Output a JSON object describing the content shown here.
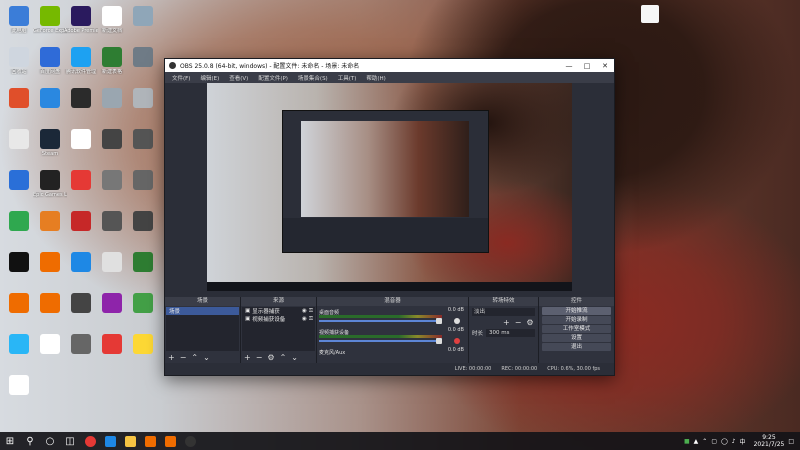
{
  "desktop": {
    "icons": [
      {
        "label": "此电脑",
        "color": "#3b7dd8"
      },
      {
        "label": "GeForce Experience",
        "color": "#76b900"
      },
      {
        "label": "Adobe Premiere Pro",
        "color": "#2a1a5e"
      },
      {
        "label": "新建文档",
        "color": "#ffffff"
      },
      {
        "label": "",
        "color": "#8fa6b8"
      },
      {
        "label": "回收站",
        "color": "#cfd6df"
      },
      {
        "label": "百度网盘",
        "color": "#2f6bd8"
      },
      {
        "label": "腾讯软件管理",
        "color": "#1da1f2"
      },
      {
        "label": "新建表格",
        "color": "#2e7d32"
      },
      {
        "label": "",
        "color": "#6f7b86"
      },
      {
        "label": "",
        "color": "#e04f2a"
      },
      {
        "label": "",
        "color": "#2a88e0"
      },
      {
        "label": "",
        "color": "#2b2b2b"
      },
      {
        "label": "",
        "color": "#9aa6b0"
      },
      {
        "label": "",
        "color": "#b0b5ba"
      },
      {
        "label": "",
        "color": "#e8e8e8"
      },
      {
        "label": "Steam",
        "color": "#1b2838"
      },
      {
        "label": "",
        "color": "#ffffff"
      },
      {
        "label": "",
        "color": "#444"
      },
      {
        "label": "",
        "color": "#555"
      },
      {
        "label": "",
        "color": "#2a6fd8"
      },
      {
        "label": "Epic Games Launcher",
        "color": "#222"
      },
      {
        "label": "",
        "color": "#e53935"
      },
      {
        "label": "",
        "color": "#777"
      },
      {
        "label": "",
        "color": "#666"
      },
      {
        "label": "",
        "color": "#2fa84f"
      },
      {
        "label": "",
        "color": "#e67e22"
      },
      {
        "label": "",
        "color": "#c62828"
      },
      {
        "label": "",
        "color": "#555"
      },
      {
        "label": "",
        "color": "#444"
      },
      {
        "label": "",
        "color": "#111"
      },
      {
        "label": "",
        "color": "#ef6c00"
      },
      {
        "label": "",
        "color": "#1e88e5"
      },
      {
        "label": "",
        "color": "#e0e0e0"
      },
      {
        "label": "",
        "color": "#2e7d32"
      },
      {
        "label": "",
        "color": "#ef6c00"
      },
      {
        "label": "",
        "color": "#ef6c00"
      },
      {
        "label": "",
        "color": "#444"
      },
      {
        "label": "",
        "color": "#8e24aa"
      },
      {
        "label": "",
        "color": "#43a047"
      },
      {
        "label": "",
        "color": "#29b6f6"
      },
      {
        "label": "",
        "color": "#ffffff"
      },
      {
        "label": "",
        "color": "#666"
      },
      {
        "label": "",
        "color": "#e53935"
      },
      {
        "label": "",
        "color": "#fdd835"
      },
      {
        "label": "",
        "color": "#ffffff"
      }
    ]
  },
  "obs": {
    "title": "OBS 25.0.8 (64-bit, windows) - 配置文件: 未命名 - 场景: 未命名",
    "menu": [
      "文件(F)",
      "编辑(E)",
      "查看(V)",
      "配置文件(P)",
      "场景集合(S)",
      "工具(T)",
      "帮助(H)"
    ],
    "docks": {
      "scenes": {
        "title": "场景",
        "items": [
          "场景"
        ]
      },
      "sources": {
        "title": "来源",
        "items": [
          "显示器捕获",
          "视频捕获设备"
        ]
      },
      "mixer": {
        "title": "混音器",
        "channels": [
          {
            "name": "桌面音频",
            "db": "0.0 dB"
          },
          {
            "name": "视频捕获设备",
            "db": "0.0 dB"
          },
          {
            "name": "麦克风/Aux",
            "db": "0.0 dB"
          }
        ]
      },
      "transitions": {
        "title": "转场特效",
        "type": "淡出",
        "duration_label": "时长",
        "duration_value": "300 ms"
      },
      "controls": {
        "title": "控件",
        "buttons": [
          "开始推流",
          "开始录制",
          "工作室模式",
          "设置",
          "退出"
        ]
      }
    },
    "status": {
      "live": "LIVE: 00:00:00",
      "rec": "REC: 00:00:00",
      "cpu": "CPU: 0.6%, 30.00 fps"
    }
  },
  "taskbar": {
    "clock_time": "9:25",
    "clock_date": "2021/7/25",
    "input_method": "中"
  }
}
